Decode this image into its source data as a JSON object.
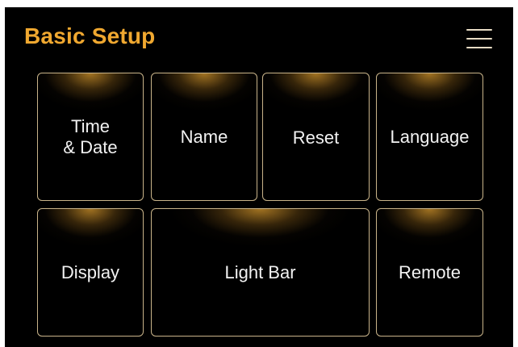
{
  "header": {
    "title": "Basic Setup",
    "menu_icon": "hamburger-menu-icon"
  },
  "tiles": [
    {
      "label": "Time\n& Date"
    },
    {
      "label": "Name"
    },
    {
      "label": "Reset"
    },
    {
      "label": "Language"
    },
    {
      "label": "Display"
    },
    {
      "label": "Light Bar"
    },
    {
      "label": "Remote"
    }
  ],
  "colors": {
    "background": "#000000",
    "title": "#f0a830",
    "tile_text": "#f2f2f2",
    "tile_border": "#c9b48a",
    "tile_glow": "#be8728",
    "menu_icon": "#e8dcc4"
  }
}
